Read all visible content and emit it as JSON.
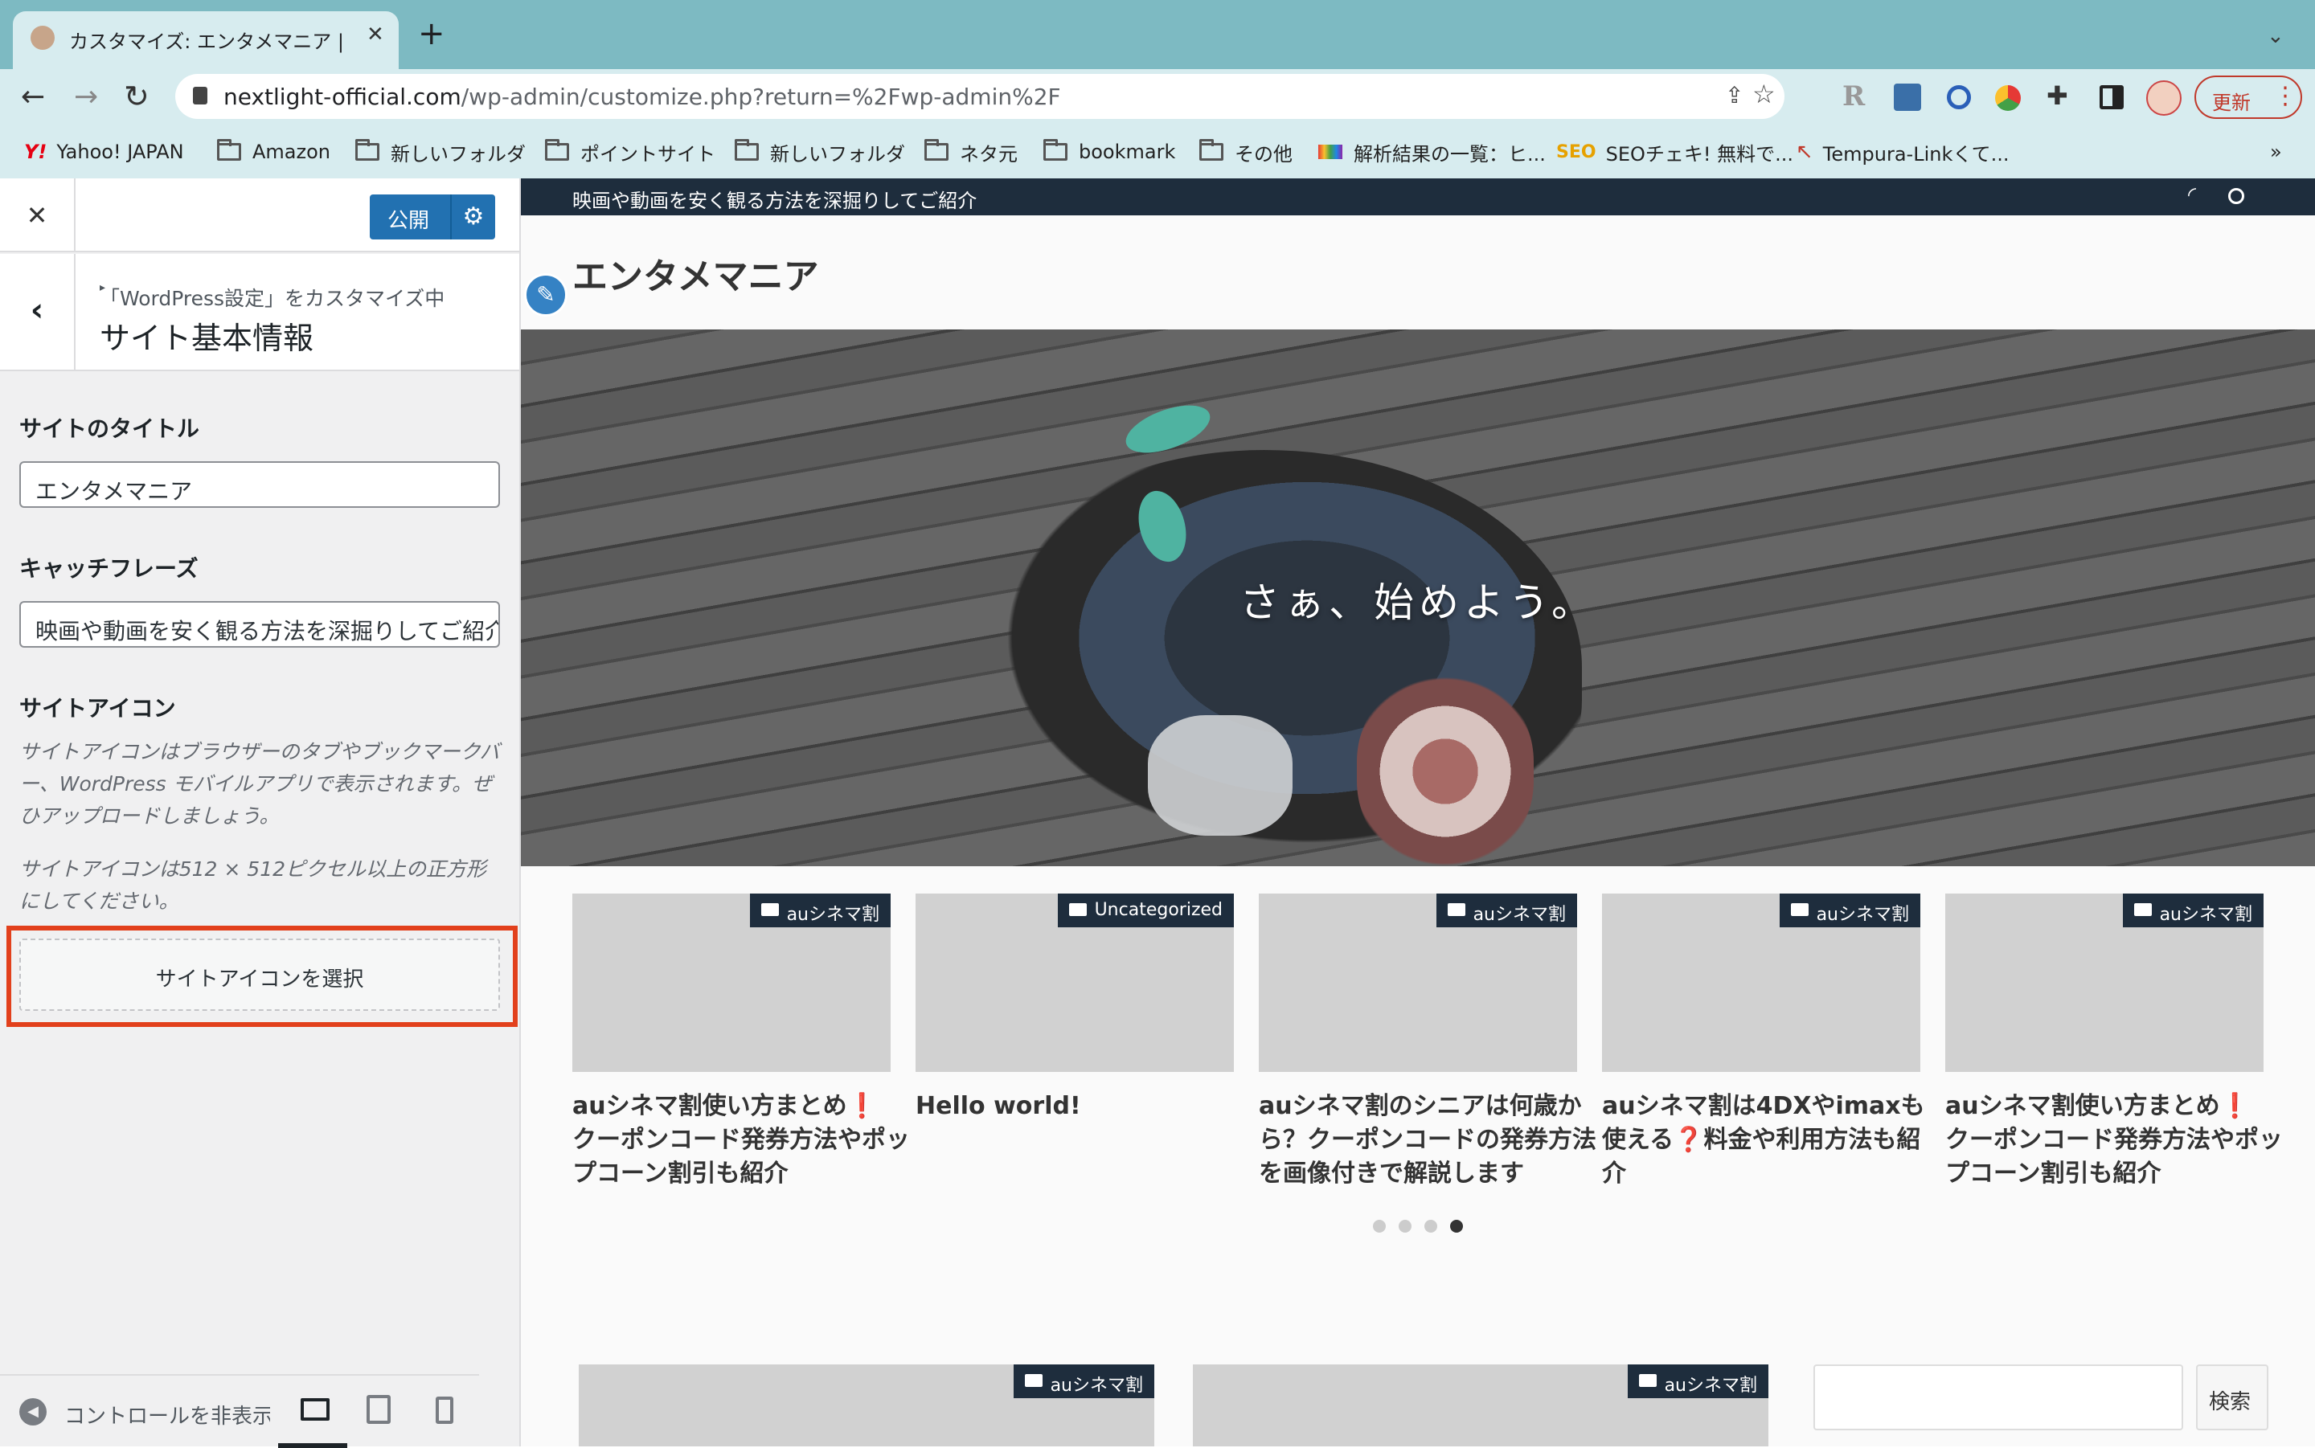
{
  "browser": {
    "tab_title": "カスタマイズ: エンタメマニア | 映",
    "new_tab": "+",
    "url_host": "nextlight-official.com",
    "url_path": "/wp-admin/customize.php?return=%2Fwp-admin%2F",
    "update_label": "更新",
    "bookmarks": [
      {
        "label": "Yahoo! JAPAN",
        "icon": "yahoo-icon"
      },
      {
        "label": "Amazon",
        "icon": "folder-icon"
      },
      {
        "label": "新しいフォルダ",
        "icon": "folder-icon"
      },
      {
        "label": "ポイントサイト",
        "icon": "folder-icon"
      },
      {
        "label": "新しいフォルダ",
        "icon": "folder-icon"
      },
      {
        "label": "ネタ元",
        "icon": "folder-icon"
      },
      {
        "label": "bookmark",
        "icon": "folder-icon"
      },
      {
        "label": "その他",
        "icon": "folder-icon"
      },
      {
        "label": "解析結果の一覧：ヒ...",
        "icon": "analytics-icon"
      },
      {
        "label": "SEOチェキ! 無料で...",
        "icon": "seo-icon"
      },
      {
        "label": "Tempura-Linkくて...",
        "icon": "tempura-icon"
      }
    ],
    "more_bookmarks": "»"
  },
  "customizer": {
    "close": "✕",
    "publish_label": "公開",
    "breadcrumb": "「WordPress設定」をカスタマイズ中",
    "section_title": "サイト基本情報",
    "site_title_label": "サイトのタイトル",
    "site_title_value": "エンタメマニア",
    "tagline_label": "キャッチフレーズ",
    "tagline_value": "映画や動画を安く観る方法を深掘りしてご紹介",
    "site_icon_label": "サイトアイコン",
    "site_icon_desc1": "サイトアイコンはブラウザーのタブやブックマークバー、WordPress モバイルアプリで表示されます。ぜひアップロードしましょう。",
    "site_icon_desc2": "サイトアイコンは512 × 512ピクセル以上の正方形にしてください。",
    "select_icon_button": "サイトアイコンを選択",
    "hide_controls": "コントロールを非表示",
    "highlight_color": "#e2401c"
  },
  "preview": {
    "topbar_text": "映画や動画を安く観る方法を深掘りしてご紹介",
    "site_name": "エンタメマニア",
    "hero_text": "さぁ、始めよう。",
    "cards": [
      {
        "category": "auシネマ割",
        "title_a": "auシネマ割使い方まとめ",
        "excl": "❗",
        "title_b": "クーポンコード発券方法やポップコーン割引も紹介"
      },
      {
        "category": "Uncategorized",
        "title_a": "Hello world!",
        "excl": "",
        "title_b": ""
      },
      {
        "category": "auシネマ割",
        "title_a": "auシネマ割のシニアは何歳から？クーポンコードの発券方法を画像付きで解説します",
        "excl": "",
        "title_b": ""
      },
      {
        "category": "auシネマ割",
        "title_a": "auシネマ割は4DXやimaxも使える",
        "excl": "❓",
        "title_b": "料金や利用方法も紹介"
      },
      {
        "category": "auシネマ割",
        "title_a": "auシネマ割使い方まとめ",
        "excl": "❗",
        "title_b": "クーポンコード発券方法やポップコーン割引も紹介"
      }
    ],
    "bottom_cards": [
      {
        "category": "auシネマ割"
      },
      {
        "category": "auシネマ割"
      }
    ],
    "search_button": "検索",
    "slider_active": 4,
    "slider_total": 4
  }
}
